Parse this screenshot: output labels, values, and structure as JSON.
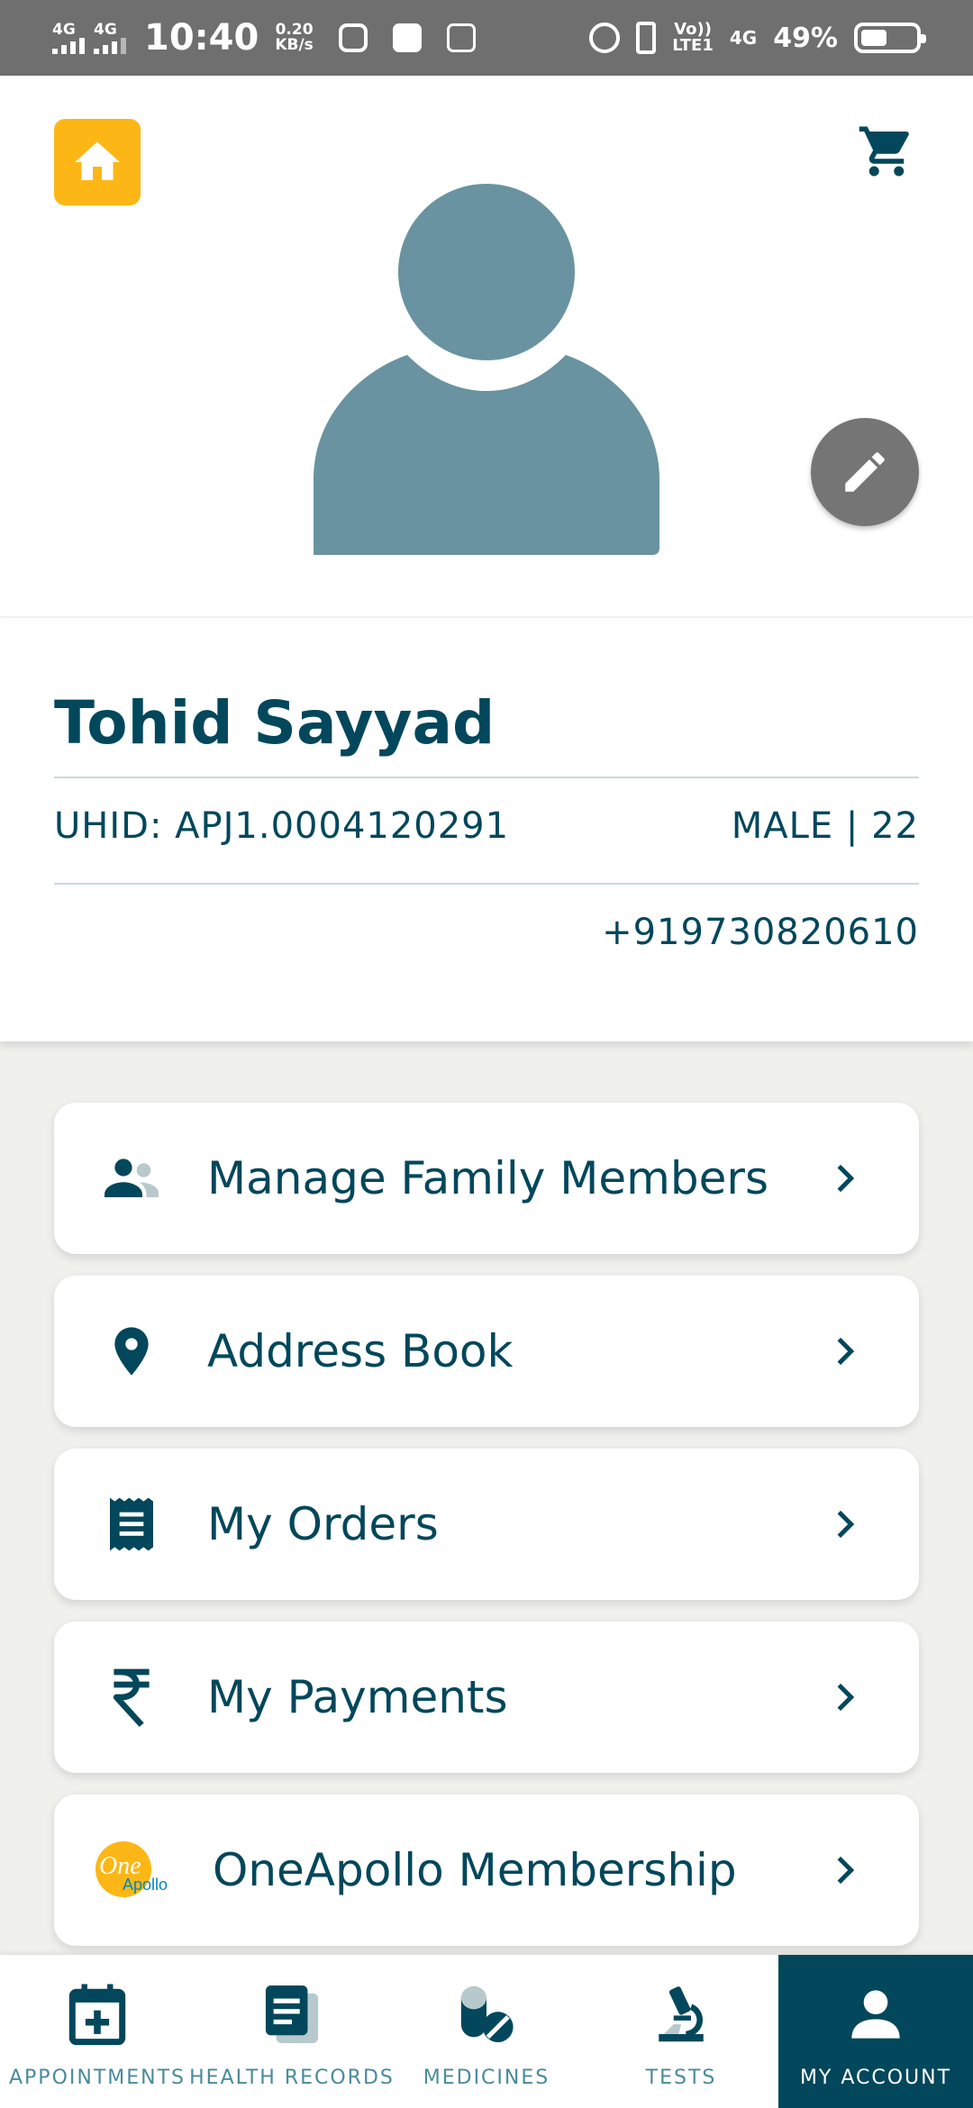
{
  "status_bar": {
    "signal1": "4G",
    "signal2": "4G",
    "time": "10:40",
    "speed_value": "0.20",
    "speed_unit": "KB/s",
    "volte_top": "Vo))",
    "volte_bottom": "LTE1",
    "network": "4G",
    "battery_percent": "49%",
    "battery_level": 0.49
  },
  "header": {
    "home_icon": "home-icon",
    "cart_icon": "cart-icon",
    "avatar_icon": "user-avatar-icon",
    "edit_icon": "pencil-icon",
    "colors": {
      "home_bg": "#fcb716",
      "avatar": "#6993a0",
      "edit_bg": "#757575"
    }
  },
  "profile": {
    "name": "Tohid Sayyad",
    "uhid": "UHID: APJ1.0004120291",
    "gender_age": "MALE | 22",
    "phone": "+919730820610"
  },
  "menu": [
    {
      "label": "Manage Family Members",
      "icon": "family-icon"
    },
    {
      "label": "Address Book",
      "icon": "location-pin-icon"
    },
    {
      "label": "My Orders",
      "icon": "receipt-icon"
    },
    {
      "label": "My Payments",
      "icon": "rupee-icon"
    },
    {
      "label": "OneApollo Membership",
      "icon": "oneapollo-logo",
      "logo_text_one": "One",
      "logo_text_apollo": "Apollo"
    }
  ],
  "bottom_nav": [
    {
      "label": "APPOINTMENTS",
      "icon": "calendar-plus-icon"
    },
    {
      "label": "HEALTH RECORDS",
      "icon": "health-records-icon"
    },
    {
      "label": "MEDICINES",
      "icon": "medicines-icon"
    },
    {
      "label": "TESTS",
      "icon": "microscope-icon"
    },
    {
      "label": "MY ACCOUNT",
      "icon": "account-icon",
      "active": true
    }
  ],
  "colors": {
    "primary": "#02475b",
    "accent": "#fcb716",
    "background": "#f0f0ed"
  }
}
